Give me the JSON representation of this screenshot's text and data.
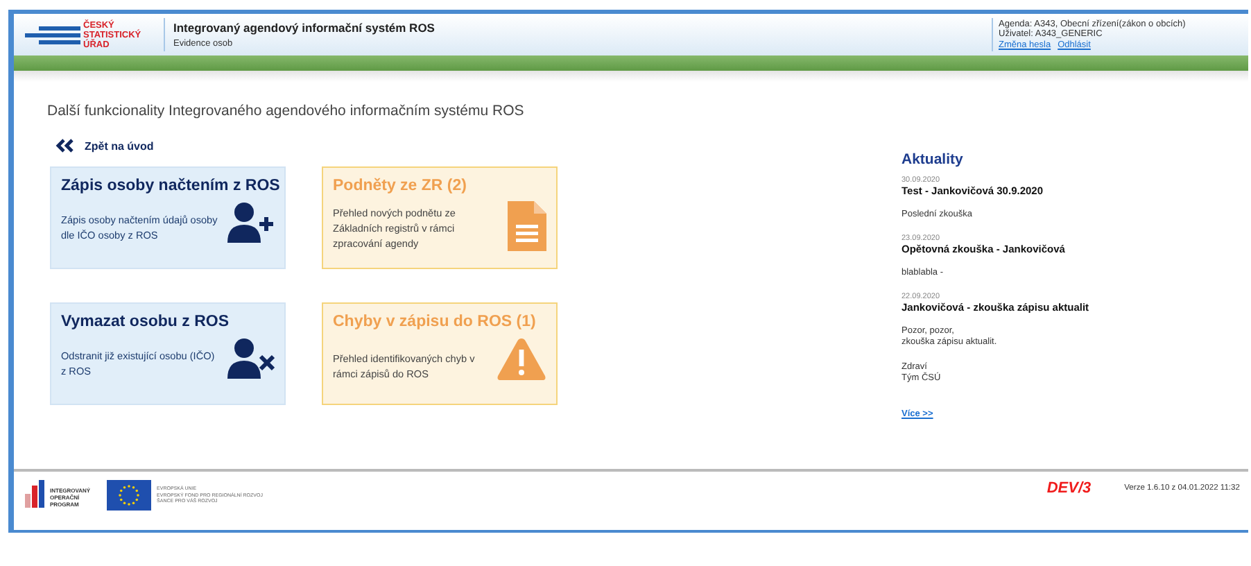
{
  "header": {
    "logo_lines": [
      "ČESKÝ",
      "STATISTICKÝ",
      "ÚŘAD"
    ],
    "title": "Integrovaný agendový informační systém ROS",
    "subtitle": "Evidence osob",
    "agenda": "Agenda:  A343, Obecní zřízení(zákon o obcích)",
    "user": "Uživatel:  A343_GENERIC",
    "links": [
      "Změna hesla",
      "Odhlásit"
    ]
  },
  "page_title": "Další funkcionality Integrovaného agendového informačním systému ROS",
  "back_link": "Zpět na úvod",
  "tiles": [
    {
      "kind": "add-person",
      "title": "Zápis osoby načtením z ROS",
      "text": "Zápis osoby načtením údajů osoby dle IČO osoby z ROS"
    },
    {
      "kind": "document",
      "title": "Podněty ze ZR (2)",
      "text": "Přehled nových podnětu ze Základních registrů v rámci zpracování agendy"
    },
    {
      "kind": "remove-person",
      "title": "Vymazat osobu z ROS",
      "text": "Odstranit již existující osobu (IČO) z ROS"
    },
    {
      "kind": "warning",
      "title": "Chyby v zápisu do ROS (1)",
      "text": "Přehled identifikovaných chyb v rámci zápisů do ROS"
    }
  ],
  "news": {
    "title": "Aktuality",
    "items": [
      {
        "date": "30.09.2020",
        "title": "Test - Jankovičová 30.9.2020",
        "body": [
          "Poslední zkouška"
        ]
      },
      {
        "date": "23.09.2020",
        "title": "Opětovná zkouška - Jankovičová",
        "body": [
          "blablabla -"
        ]
      },
      {
        "date": "22.09.2020",
        "title": "Jankovičová - zkouška zápisu aktualit",
        "body": [
          "Pozor, pozor,\nzkouška zápisu aktualit.",
          "Zdraví\nTým ČSÚ"
        ]
      }
    ],
    "more": "Více >>"
  },
  "footer": {
    "iop_lines": [
      "INTEGROVANÝ",
      "OPERAČNÍ",
      "PROGRAM"
    ],
    "eu_lines": [
      "EVROPSKÁ UNIE",
      "EVROPSKÝ FOND PRO REGIONÁLNÍ ROZVOJ",
      "ŠANCE PRO VÁŠ ROZVOJ"
    ],
    "env": "DEV/3",
    "version": "Verze 1.6.10 z 04.01.2022 11:32"
  }
}
